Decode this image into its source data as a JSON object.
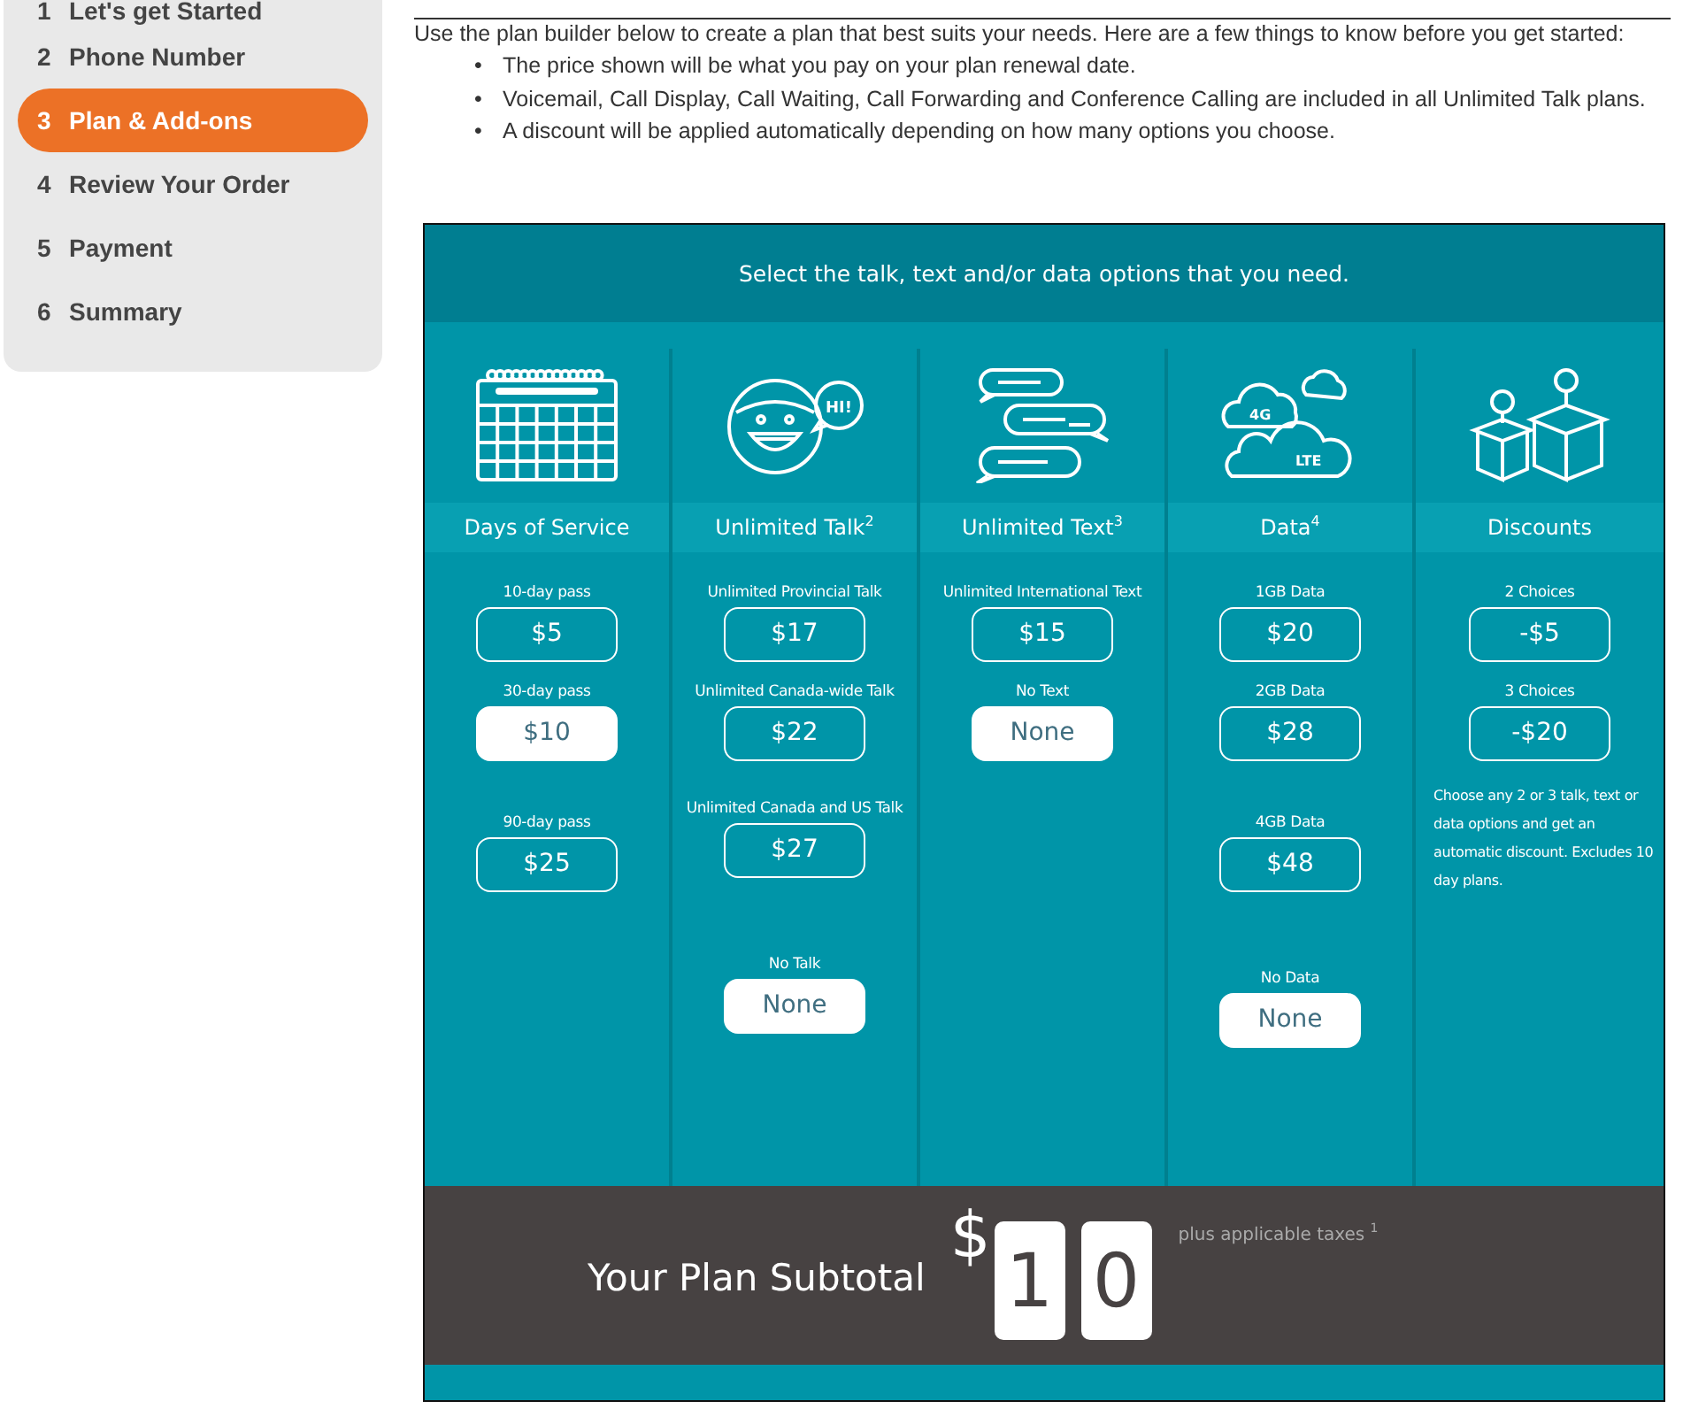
{
  "steps": [
    {
      "number": "1",
      "label": "Let's get Started",
      "selected": false
    },
    {
      "number": "2",
      "label": "Phone Number",
      "selected": false
    },
    {
      "number": "3",
      "label": "Plan & Add-ons",
      "selected": true
    },
    {
      "number": "4",
      "label": "Review Your Order",
      "selected": false
    },
    {
      "number": "5",
      "label": "Payment",
      "selected": false
    },
    {
      "number": "6",
      "label": "Summary",
      "selected": false
    }
  ],
  "intro": {
    "marker": "•",
    "text": "Use the plan builder below to create a plan that best suits your needs. Here are a few things to know before you get started:",
    "bullets": [
      "The price shown will be what you pay on your plan renewal date.",
      "Voicemail, Call Display, Call Waiting, Call Forwarding and Conference Calling are included in all Unlimited Talk plans.",
      "A discount will be applied automatically depending on how many options you choose."
    ]
  },
  "builder": {
    "title": "Select the talk, text and/or data options that you need.",
    "columns": [
      {
        "kind": "calendar",
        "heading": "Days of Service",
        "options": [
          {
            "label": "10-day pass",
            "price": "$5",
            "selected": false
          },
          {
            "label": "30-day pass",
            "price": "$10",
            "selected": true
          },
          {
            "label": "90-day pass",
            "price": "$25",
            "selected": false
          }
        ]
      },
      {
        "kind": "talk",
        "icon_texts": [
          "HI!"
        ],
        "heading": "Unlimited Talk$^{2}$",
        "options": [
          {
            "label": "Unlimited Provincial Talk",
            "price": "$17",
            "selected": false
          },
          {
            "label": "Unlimited Canada-wide Talk",
            "price": "$22",
            "selected": false
          },
          {
            "label": "Unlimited Canada and US Talk",
            "price": "$27",
            "selected": false
          },
          {
            "label": "No Talk",
            "price": "None",
            "selected": true
          }
        ]
      },
      {
        "kind": "text",
        "heading": "Unlimited Text$^{3}$",
        "options": [
          {
            "label": "Unlimited International Text",
            "price": "$15",
            "selected": false
          },
          {
            "label": "No Text",
            "price": "None",
            "selected": true
          }
        ]
      },
      {
        "kind": "data",
        "icon_texts": [
          "4G",
          "LTE"
        ],
        "heading": "Data$^{4}$",
        "options": [
          {
            "label": "1GB Data",
            "price": "$20",
            "selected": false
          },
          {
            "label": "2GB Data",
            "price": "$28",
            "selected": false
          },
          {
            "label": "4GB Data",
            "price": "$48",
            "selected": false
          },
          {
            "label": "No Data",
            "price": "None",
            "selected": true
          }
        ]
      },
      {
        "kind": "discount",
        "heading": "Discounts",
        "options": [
          {
            "label": "2 Choices",
            "price": "-$5",
            "selected": false
          },
          {
            "label": "3 Choices",
            "price": "-$20",
            "selected": false
          }
        ],
        "note": "Choose any 2 or 3 talk, text or data options and get an automatic discount. Excludes 10 day plans."
      }
    ]
  },
  "subtotal": {
    "label": "Your Plan Subtotal",
    "currency": "$",
    "digits": [
      "1",
      "0"
    ],
    "taxes": "plus applicable taxes $^{1}$"
  }
}
